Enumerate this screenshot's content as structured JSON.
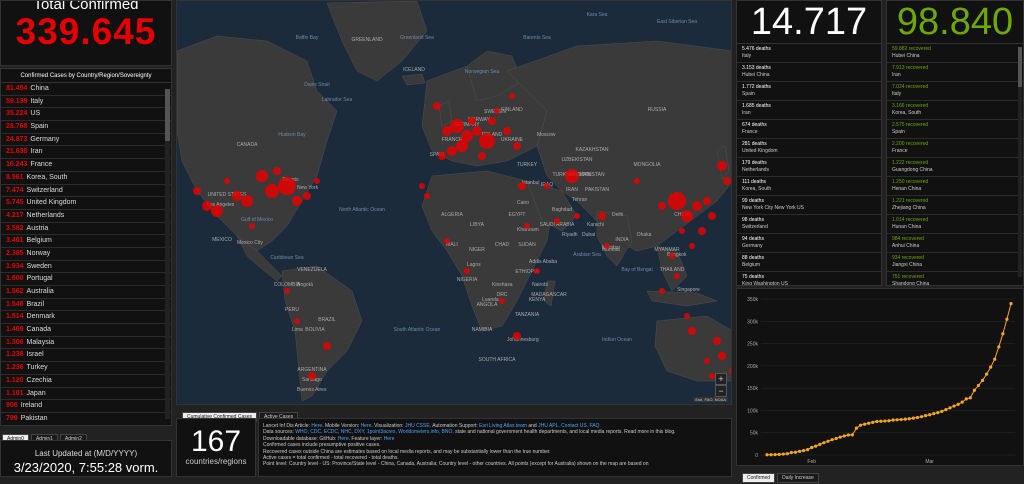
{
  "total": {
    "label": "Total Confirmed",
    "value": "339.645"
  },
  "countries": {
    "header": "Confirmed Cases by Country/Region/Sovereignty",
    "rows": [
      {
        "n": "81.454",
        "c": "China"
      },
      {
        "n": "59.138",
        "c": "Italy"
      },
      {
        "n": "35.224",
        "c": "US"
      },
      {
        "n": "28.768",
        "c": "Spain"
      },
      {
        "n": "24.873",
        "c": "Germany"
      },
      {
        "n": "21.638",
        "c": "Iran"
      },
      {
        "n": "16.243",
        "c": "France"
      },
      {
        "n": "8.961",
        "c": "Korea, South"
      },
      {
        "n": "7.474",
        "c": "Switzerland"
      },
      {
        "n": "5.745",
        "c": "United Kingdom"
      },
      {
        "n": "4.217",
        "c": "Netherlands"
      },
      {
        "n": "3.582",
        "c": "Austria"
      },
      {
        "n": "3.401",
        "c": "Belgium"
      },
      {
        "n": "2.385",
        "c": "Norway"
      },
      {
        "n": "1.934",
        "c": "Sweden"
      },
      {
        "n": "1.600",
        "c": "Portugal"
      },
      {
        "n": "1.562",
        "c": "Australia"
      },
      {
        "n": "1.546",
        "c": "Brazil"
      },
      {
        "n": "1.514",
        "c": "Denmark"
      },
      {
        "n": "1.469",
        "c": "Canada"
      },
      {
        "n": "1.306",
        "c": "Malaysia"
      },
      {
        "n": "1.238",
        "c": "Israel"
      },
      {
        "n": "1.236",
        "c": "Turkey"
      },
      {
        "n": "1.120",
        "c": "Czechia"
      },
      {
        "n": "1.101",
        "c": "Japan"
      },
      {
        "n": "906",
        "c": "Ireland"
      },
      {
        "n": "799",
        "c": "Pakistan"
      }
    ],
    "tabs": [
      "Admin0",
      "Admin1",
      "Admin2"
    ]
  },
  "updated": {
    "label": "Last Updated at (M/D/YYYY)",
    "value": "3/23/2020, 7:55:28 vorm."
  },
  "map": {
    "labels": {
      "oceans": [
        "Baffin Bay",
        "Greenland Sea",
        "Davis Strait",
        "Labrador Sea",
        "Hudson Bay",
        "North Atlantic Ocean",
        "Norwegian Sea",
        "Barents Sea",
        "Kara Sea",
        "East Siberian Sea",
        "South Atlantic Ocean",
        "Indian Ocean",
        "Arabian Sea",
        "Caribbean Sea",
        "Bay of Bengal",
        "Gulf of Mexico"
      ],
      "lands": [
        "GREENLAND",
        "ICELAND",
        "CANADA",
        "UNITED STATES",
        "MEXICO",
        "RUSSIA",
        "NORWAY",
        "SWEDEN",
        "FINLAND",
        "KAZAKHSTAN",
        "MONGOLIA",
        "CHINA",
        "INDIA",
        "IRAN",
        "IRAQ",
        "SAUDI ARABIA",
        "EGYPT",
        "LIBYA",
        "ALGERIA",
        "MALI",
        "NIGER",
        "CHAD",
        "SUDAN",
        "NIGERIA",
        "ETHIOPIA",
        "DRC",
        "ANGOLA",
        "NAMIBIA",
        "SOUTH AFRICA",
        "BRAZIL",
        "PERU",
        "BOLIVIA",
        "ARGENTINA",
        "COLOMBIA",
        "VENEZUELA",
        "TURKEY",
        "UKRAINE",
        "POLAND",
        "KENYA",
        "TANZANIA",
        "MADAGASCAR",
        "MYANMAR",
        "THAILAND",
        "SPAIN",
        "FRANCE",
        "GERMANY",
        "AFGHANISTAN",
        "PAKISTAN",
        "UZBEKISTAN",
        "TURKMENISTAN"
      ],
      "cities": [
        "Toronto",
        "New York",
        "Los Angeles",
        "Mexico City",
        "Moscow",
        "Istanbul",
        "Cairo",
        "Baghdad",
        "Tehran",
        "Riyadh",
        "Dubai",
        "Mumbai",
        "Delhi",
        "Karachi",
        "Lagos",
        "Kinshasa",
        "Lima",
        "Bogotá",
        "Buenos Aires",
        "Singapore",
        "Bangkok",
        "Dhaka",
        "Santiago",
        "Johannesburg",
        "Nairobi",
        "Addis Ababa",
        "Khartoum",
        "Luanda",
        "Mumbai"
      ]
    },
    "attribution": "Esri, FAO, NOAA",
    "tabs": [
      "Cumulative Confirmed Cases",
      "Active Cases"
    ],
    "zoom_in": "+",
    "zoom_out": "−"
  },
  "countries_count": {
    "value": "167",
    "label": "countries/regions"
  },
  "info": {
    "line1a": "Lancet Inf Dis Article: ",
    "line1b": "Here",
    "line1c": ". Mobile Version: ",
    "line1d": "Here",
    "line1e": ". Visualization: ",
    "line1f": "JHU CSSE",
    "line1g": ". Automation Support: ",
    "line1h": "Esri Living Atlas team",
    "line1i": " and ",
    "line1j": "JHU APL",
    "line1k": ". Contact US. ",
    "line1l": "FAQ",
    "line2a": "Data sources: ",
    "line2b": "WHO, CDC, ECDC, NHC, DXY, 1point3acres, Worldometers.info, BNO,",
    "line2c": " state and national government health departments, and local media reports.  Read more in this blog.",
    "line3a": "Downloadable database: GitHub: ",
    "line3b": "Here",
    "line3c": ". Feature layer: ",
    "line3d": "Here",
    "line4": "Confirmed cases include presumptive positive cases.",
    "line5": "Recovered cases outside China are estimates based on local media reports, and may be substantially lower than the true number.",
    "line6": "Active cases = total confirmed - total recovered - total deaths.",
    "line7": "Point level: Country level - US: Province/State level - China, Canada, Australia; Country level - other countries. All points (except for Australia) shown on the map are based on"
  },
  "deaths": {
    "total": "14.717",
    "rows": [
      {
        "d": "5.476 deaths",
        "p": "Italy"
      },
      {
        "d": "3.153 deaths",
        "p": "Hubei China"
      },
      {
        "d": "1.772 deaths",
        "p": "Spain"
      },
      {
        "d": "1.685 deaths",
        "p": "Iran"
      },
      {
        "d": "674 deaths",
        "p": "France"
      },
      {
        "d": "281 deaths",
        "p": "United Kingdom"
      },
      {
        "d": "179 deaths",
        "p": "Netherlands"
      },
      {
        "d": "111 deaths",
        "p": "Korea, South"
      },
      {
        "d": "99 deaths",
        "p": "New York City New York US"
      },
      {
        "d": "98 deaths",
        "p": "Switzerland"
      },
      {
        "d": "94 deaths",
        "p": "Germany"
      },
      {
        "d": "88 deaths",
        "p": "Belgium"
      },
      {
        "d": "75 deaths",
        "p": "King Washington US"
      }
    ]
  },
  "recovered": {
    "total": "98.840",
    "rows": [
      {
        "d": "59.882 recovered",
        "p": "Hubei China"
      },
      {
        "d": "7.913 recovered",
        "p": "Iran"
      },
      {
        "d": "7.024 recovered",
        "p": "Italy"
      },
      {
        "d": "3.166 recovered",
        "p": "Korea, South"
      },
      {
        "d": "2.575 recovered",
        "p": "Spain"
      },
      {
        "d": "2.200 recovered",
        "p": "France"
      },
      {
        "d": "1.222 recovered",
        "p": "Guangdong China"
      },
      {
        "d": "1.250 recovered",
        "p": "Henan China"
      },
      {
        "d": "1.221 recovered",
        "p": "Zhejiang China"
      },
      {
        "d": "1.014 recovered",
        "p": "Hunan China"
      },
      {
        "d": "984 recovered",
        "p": "Anhui China"
      },
      {
        "d": "934 recovered",
        "p": "Jiangxi China"
      },
      {
        "d": "751 recovered",
        "p": "Shandong China"
      }
    ]
  },
  "chart_data": {
    "type": "line",
    "y_tick_labels": [
      "0",
      "50k",
      "100k",
      "150k",
      "200k",
      "250k",
      "300k",
      "350k"
    ],
    "x_tick_labels": [
      "Feb",
      "Mar"
    ],
    "ylim": [
      0,
      350000
    ],
    "color": "#f5a623",
    "series": [
      {
        "values": [
          555,
          653,
          941,
          1438,
          2118,
          2927,
          5578,
          6166,
          8234,
          9927,
          12038,
          16787,
          19881,
          23892,
          27635,
          30817,
          34391,
          37120,
          40150,
          42762,
          44802,
          45221,
          60368,
          66885,
          69030,
          71224,
          73258,
          75136,
          75639,
          76197,
          76819,
          78572,
          78958,
          79561,
          80406,
          81388,
          82746,
          84112,
          86011,
          88369,
          90306,
          92840,
          95120,
          97886,
          101800,
          105847,
          109821,
          113590,
          118620,
          125875,
          128343,
          145193,
          156097,
          167449,
          181546,
          197168,
          214915,
          242713,
          272167,
          304524,
          339645
        ]
      }
    ]
  },
  "chart_tabs": [
    "Confirmed",
    "Daily Increase"
  ]
}
